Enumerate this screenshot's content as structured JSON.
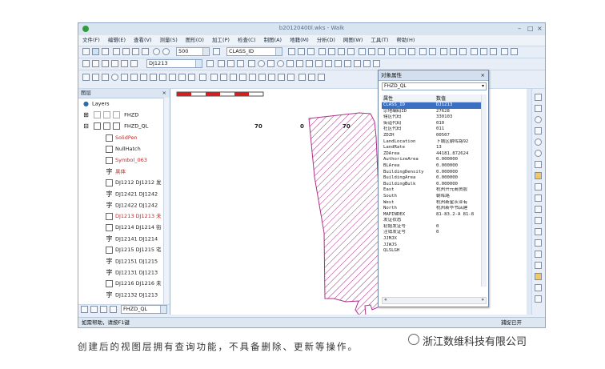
{
  "window": {
    "title": "b20120400l.wks - Walk"
  },
  "menu": [
    "文件(F)",
    "编辑(E)",
    "查看(V)",
    "测量(S)",
    "图形(O)",
    "加工(P)",
    "检查(C)",
    "制图(A)",
    "地籍(M)",
    "分析(D)",
    "网图(W)",
    "工具(T)",
    "帮助(H)"
  ],
  "toolbar": {
    "zoom_value": "500",
    "layer_field": "CLASS_ID",
    "feature_id": "DJ1213",
    "bottom_layer": "FHZD_QL"
  },
  "layers_panel": {
    "header": "图层",
    "root": "Layers",
    "groups": [
      "FHZD",
      "FHZD_QL"
    ],
    "items": [
      {
        "label": "SolidPen",
        "color": "#d02020"
      },
      {
        "label": "NullHatch",
        "color": "#222222"
      },
      {
        "label": "Symbol_063",
        "color": "#d02020"
      },
      {
        "label": "黑体",
        "color": "#d02020",
        "glyph": "字"
      },
      {
        "label": "DJ1212 DJ1212 发",
        "color": "#222222"
      },
      {
        "label": "DJ12421 DJ1242",
        "color": "#222222",
        "glyph": "字"
      },
      {
        "label": "DJ12422 DJ1242",
        "color": "#222222",
        "glyph": "字"
      },
      {
        "label": "DJ1213 DJ1213 未",
        "color": "#d02020"
      },
      {
        "label": "DJ1214 DJ1214 街",
        "color": "#222222"
      },
      {
        "label": "DJ12141 DJ1214",
        "color": "#222222",
        "glyph": "字"
      },
      {
        "label": "DJ1215 DJ1215 宅",
        "color": "#222222"
      },
      {
        "label": "DJ12151 DJ1215",
        "color": "#222222",
        "glyph": "字"
      },
      {
        "label": "DJ12131 DJ1213",
        "color": "#222222",
        "glyph": "字"
      },
      {
        "label": "DJ1216 DJ1216 未",
        "color": "#222222"
      },
      {
        "label": "DJ12132 DJ1213",
        "color": "#222222",
        "glyph": "字"
      }
    ]
  },
  "scalebar": {
    "labels": [
      "70",
      "0",
      "70"
    ]
  },
  "property_dialog": {
    "title": "对象属性",
    "selected_layer": "FHZD_QL",
    "columns": [
      "属性",
      "数值"
    ],
    "rows": [
      [
        "CLASS_ID",
        "DJ1213"
      ],
      [
        "宗地编码ID",
        "27628"
      ],
      [
        "辖区代码",
        "330103"
      ],
      [
        "街道代码",
        "010"
      ],
      [
        "社区代码",
        "011"
      ],
      [
        "ZDZH",
        "00507"
      ],
      [
        "LandLocation",
        "下城区朝晖路92"
      ],
      [
        "LandRate",
        "13"
      ],
      [
        "ZDArea",
        "44181.872624"
      ],
      [
        "AuthorizeArea",
        "0.000000"
      ],
      [
        "BLArea",
        "0.000000"
      ],
      [
        "BuildingDensity",
        "0.000000"
      ],
      [
        "BuildingArea",
        "0.000000"
      ],
      [
        "BuildingBulk",
        "0.000000"
      ],
      [
        "East",
        "杭州开元商贸股"
      ],
      [
        "South",
        "朝晖路"
      ],
      [
        "West",
        "杭州新星灰业有"
      ],
      [
        "North",
        "杭州新华书店建"
      ],
      [
        "MAPINDEX",
        "81-83.2-A 81-8"
      ],
      [
        "发证状态",
        ""
      ],
      [
        "初始发证号",
        "0"
      ],
      [
        "注销发证号",
        "0"
      ],
      [
        "JJMJX",
        ""
      ],
      [
        "JJWJS",
        ""
      ],
      [
        "QLSLGH",
        ""
      ]
    ],
    "selected_index": 0
  },
  "status": {
    "left": "如需帮助，请按F1键",
    "right": "捕捉已开"
  },
  "caption": "创建后的视图层拥有查询功能，不具备删除、更新等操作。",
  "watermark": "浙江数维科技有限公司"
}
